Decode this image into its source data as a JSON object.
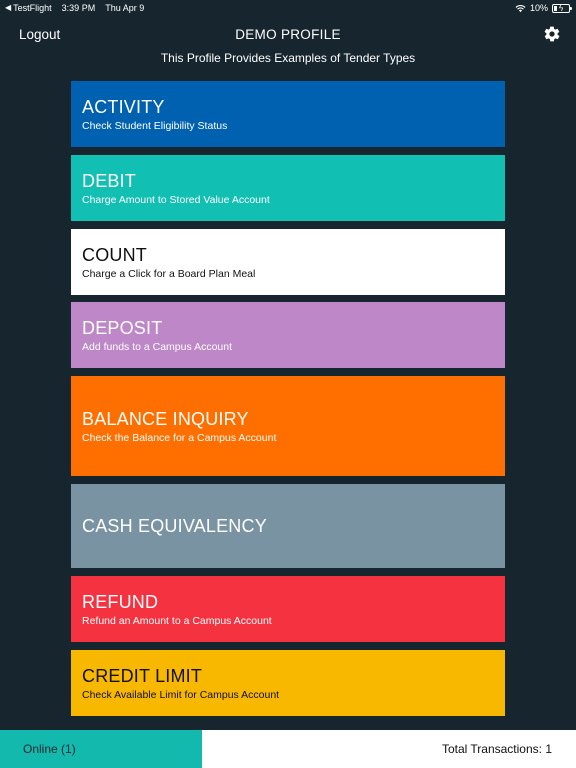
{
  "status_bar": {
    "back_app": "TestFlight",
    "time": "3:39 PM",
    "date": "Thu Apr 9",
    "battery": "10%"
  },
  "header": {
    "logout_label": "Logout",
    "title": "DEMO PROFILE",
    "subtitle": "This Profile Provides Examples of Tender Types",
    "settings_icon": "gear-icon"
  },
  "tiles": [
    {
      "title": "ACTIVITY",
      "subtitle": "Check Student Eligibility Status",
      "bg": "#0061b0",
      "fg": "#ffffff"
    },
    {
      "title": "DEBIT",
      "subtitle": "Charge Amount to Stored Value Account",
      "bg": "#12bfb3",
      "fg": "#ffffff"
    },
    {
      "title": "COUNT",
      "subtitle": "Charge a Click for a Board Plan Meal",
      "bg": "#ffffff",
      "fg": "#111111"
    },
    {
      "title": "DEPOSIT",
      "subtitle": "Add funds to a Campus Account",
      "bg": "#be87c8",
      "fg": "#ffffff"
    },
    {
      "title": "BALANCE INQUIRY",
      "subtitle": "Check the Balance for a Campus Account",
      "bg": "#ff6f00",
      "fg": "#ffffff"
    },
    {
      "title": "CASH EQUIVALENCY",
      "subtitle": "",
      "bg": "#7a93a2",
      "fg": "#ffffff"
    },
    {
      "title": "REFUND",
      "subtitle": "Refund an Amount to a Campus Account",
      "bg": "#f53240",
      "fg": "#ffffff"
    },
    {
      "title": "CREDIT LIMIT",
      "subtitle": "Check Available Limit for Campus Account",
      "bg": "#f8b800",
      "fg": "#111111"
    }
  ],
  "footer": {
    "online_label": "Online (1)",
    "transactions_label": "Total Transactions: 1",
    "online_color": "#13b9ad"
  }
}
